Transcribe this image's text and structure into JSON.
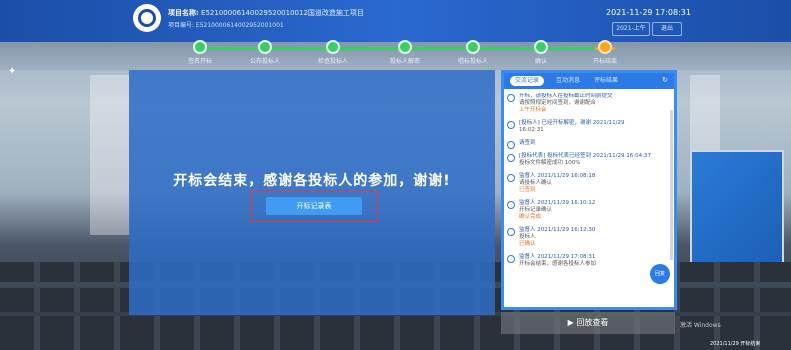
{
  "header": {
    "project_label": "项目名称:",
    "project_name": "E52100006140029520010012国道改造施工项目",
    "project_code": "项目编号: E5210000614002952001001",
    "datetime": "2021-11-29 17:08:31",
    "btn1": "2021-上午",
    "btn2": "退出"
  },
  "progress": {
    "steps": [
      {
        "label": "签名开标"
      },
      {
        "label": "公布投标人"
      },
      {
        "label": "检查投标人"
      },
      {
        "label": "投标人解密"
      },
      {
        "label": "唱标投标人"
      },
      {
        "label": "确认"
      },
      {
        "label": "开标结束"
      }
    ]
  },
  "main": {
    "message": "开标会结束，感谢各投标人的参加，谢谢!",
    "open_record_button": "开标记录表"
  },
  "side": {
    "tabs": [
      "交流记录",
      "互动消息",
      "评标结果"
    ],
    "chat": [
      {
        "head": "开标，请投标人在投标截止时间前提交",
        "body": "请按照规定时间签到，谢谢配合",
        "hl": "上午开标会"
      },
      {
        "head": "[投标人] 已经开标解密，谢谢 2021/11/29",
        "body": "16:02:31",
        "hl": ""
      },
      {
        "head": "请签到",
        "body": "",
        "hl": ""
      },
      {
        "head": "[投标代表] 投标代表已经签到 2021/11/29 16:04:37",
        "body": "投标文件解密成功 100%",
        "hl": ""
      },
      {
        "head": "监督人 2021/11/29 16:08:18",
        "body": "请投标人确认",
        "hl": "已签到"
      },
      {
        "head": "监督人 2021/11/29 16:10:12",
        "body": "开标记录确认",
        "hl": "确认完成"
      },
      {
        "head": "监督人 2021/11/29 16:12:30",
        "body": "投标人",
        "hl": "已确认"
      },
      {
        "head": "监督人 2021/11/29 17:08:31",
        "body": "开标会结束，感谢各投标人参加",
        "hl": ""
      }
    ],
    "float_button": "回复",
    "replay_button": "回放查看"
  },
  "footer": {
    "watermark_note": "激活 Windows",
    "taskbar": "2021/11/29 开标结束"
  }
}
